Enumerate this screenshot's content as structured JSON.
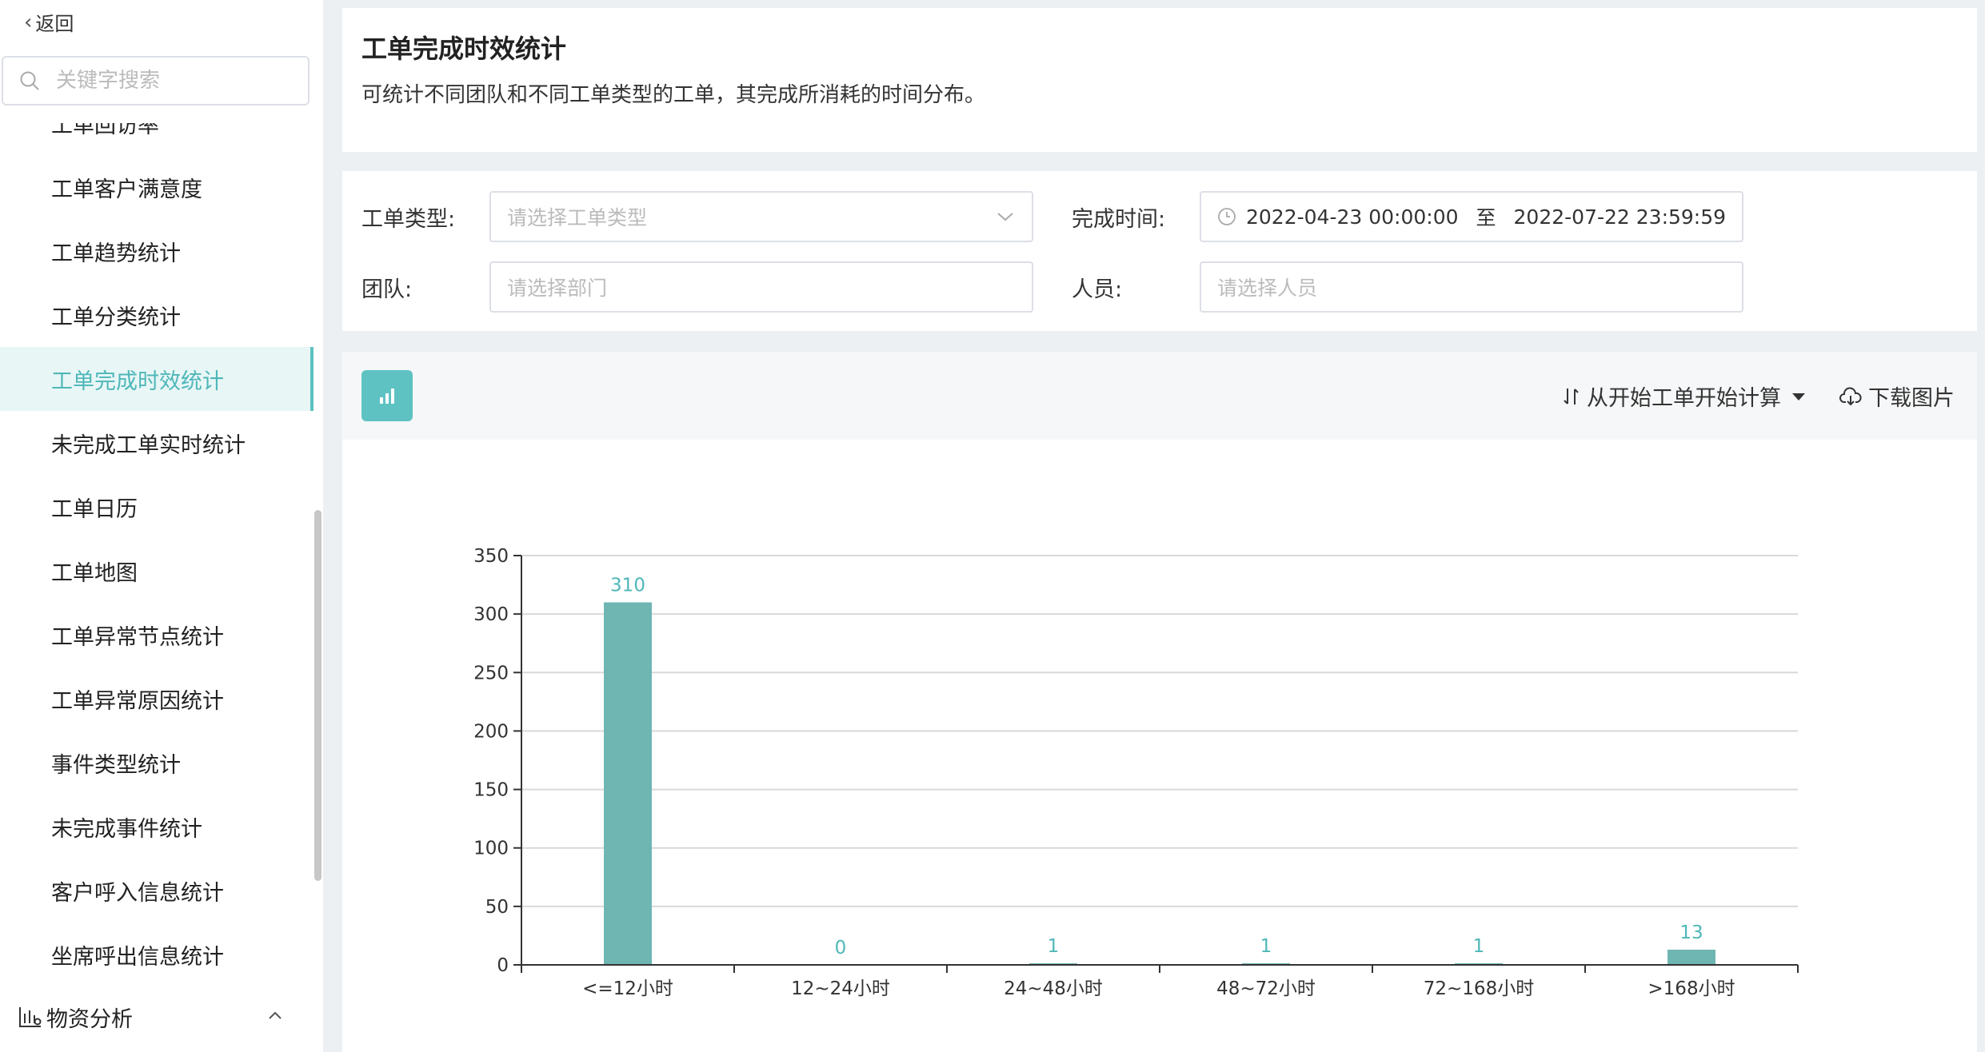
{
  "sidebar": {
    "back_label": "返回",
    "search_placeholder": "关键字搜索",
    "partial_item": "工单回访率",
    "items": [
      {
        "label": "工单客户满意度",
        "active": false
      },
      {
        "label": "工单趋势统计",
        "active": false
      },
      {
        "label": "工单分类统计",
        "active": false
      },
      {
        "label": "工单完成时效统计",
        "active": true
      },
      {
        "label": "未完成工单实时统计",
        "active": false
      },
      {
        "label": "工单日历",
        "active": false
      },
      {
        "label": "工单地图",
        "active": false
      },
      {
        "label": "工单异常节点统计",
        "active": false
      },
      {
        "label": "工单异常原因统计",
        "active": false
      },
      {
        "label": "事件类型统计",
        "active": false
      },
      {
        "label": "未完成事件统计",
        "active": false
      },
      {
        "label": "客户呼入信息统计",
        "active": false
      },
      {
        "label": "坐席呼出信息统计",
        "active": false
      }
    ],
    "group_label": "物资分析"
  },
  "header": {
    "title": "工单完成时效统计",
    "description": "可统计不同团队和不同工单类型的工单，其完成所消耗的时间分布。"
  },
  "filters": {
    "type_label": "工单类型:",
    "type_placeholder": "请选择工单类型",
    "time_label": "完成时间:",
    "time_start": "2022-04-23 00:00:00",
    "time_sep": "至",
    "time_end": "2022-07-22 23:59:59",
    "team_label": "团队:",
    "team_placeholder": "请选择部门",
    "person_label": "人员:",
    "person_placeholder": "请选择人员"
  },
  "toolbar": {
    "calc_mode": "从开始工单开始计算",
    "download": "下载图片"
  },
  "colors": {
    "accent": "#5ec2c3",
    "bar": "#6fb6b3",
    "active_text": "#4fb7b9"
  },
  "chart_data": {
    "type": "bar",
    "categories": [
      "<=12小时",
      "12~24小时",
      "24~48小时",
      "48~72小时",
      "72~168小时",
      ">168小时"
    ],
    "values": [
      310,
      0,
      1,
      1,
      1,
      13
    ],
    "ylim": [
      0,
      350
    ],
    "yticks": [
      0,
      50,
      100,
      150,
      200,
      250,
      300,
      350
    ],
    "grid": true,
    "data_labels": true
  }
}
